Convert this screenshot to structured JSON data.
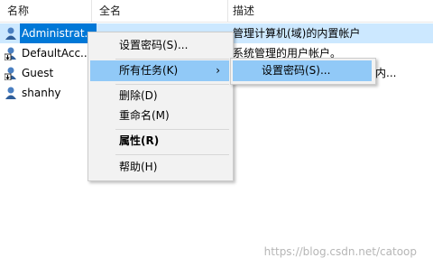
{
  "columns": [
    "名称",
    "全名",
    "描述"
  ],
  "rows": [
    {
      "name": "Administrat...",
      "desc": "管理计算机(域)的内置帐户",
      "selected": true,
      "icon": "user-icon"
    },
    {
      "name": "DefaultAcc...",
      "desc": "系统管理的用户帐户。",
      "selected": false,
      "icon": "user-download-icon"
    },
    {
      "name": "Guest",
      "desc": "内...",
      "selected": false,
      "icon": "user-download-icon"
    },
    {
      "name": "shanhy",
      "desc": "",
      "selected": false,
      "icon": "user-icon"
    }
  ],
  "context_menu": {
    "set_password": "设置密码(S)...",
    "all_tasks": "所有任务(K)",
    "all_tasks_arrow": "›",
    "delete": "删除(D)",
    "rename": "重命名(M)",
    "properties": "属性(R)",
    "help": "帮助(H)"
  },
  "submenu": {
    "set_password": "设置密码(S)..."
  },
  "watermark": "https://blog.csdn.net/catoop",
  "colors": {
    "selection": "#0078d7",
    "row_highlight": "#cce8ff",
    "menu_highlight": "#91c9f7"
  }
}
